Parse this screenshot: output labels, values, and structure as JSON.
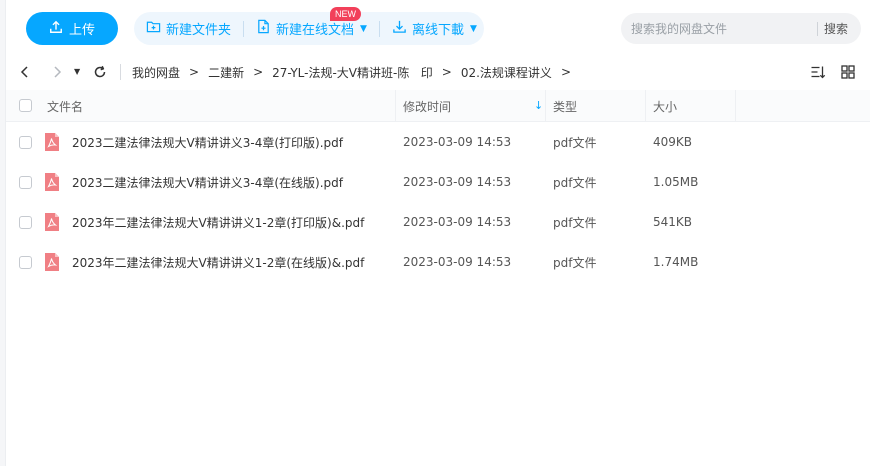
{
  "toolbar": {
    "upload_label": "上传",
    "new_folder_label": "新建文件夹",
    "new_online_doc_label": "新建在线文档",
    "new_badge": "NEW",
    "offline_download_label": "离线下載",
    "accent_color": "#06a7ff"
  },
  "search": {
    "placeholder": "搜索我的网盘文件",
    "button_label": "搜索"
  },
  "breadcrumb": [
    "我的网盘",
    "二建新",
    "27-YL-法规-大V精讲班-陈   印",
    "02.法规课程讲义"
  ],
  "table": {
    "columns": [
      "文件名",
      "修改时间",
      "类型",
      "大小"
    ],
    "rows": [
      {
        "name": "2023二建法律法规大V精讲讲义3-4章(打印版).pdf",
        "modified": "2023-03-09 14:53",
        "type": "pdf文件",
        "size": "409KB"
      },
      {
        "name": "2023二建法律法规大V精讲讲义3-4章(在线版).pdf",
        "modified": "2023-03-09 14:53",
        "type": "pdf文件",
        "size": "1.05MB"
      },
      {
        "name": "2023年二建法律法规大V精讲讲义1-2章(打印版)&.pdf",
        "modified": "2023-03-09 14:53",
        "type": "pdf文件",
        "size": "541KB"
      },
      {
        "name": "2023年二建法律法规大V精讲讲义1-2章(在线版)&.pdf",
        "modified": "2023-03-09 14:53",
        "type": "pdf文件",
        "size": "1.74MB"
      }
    ]
  },
  "icons": {
    "upload": "upload-icon",
    "new_folder": "folder-plus-icon",
    "new_doc": "document-plus-icon",
    "download": "download-icon",
    "file": "pdf-file-icon",
    "sort": "sort-list-icon",
    "grid": "grid-view-icon"
  }
}
